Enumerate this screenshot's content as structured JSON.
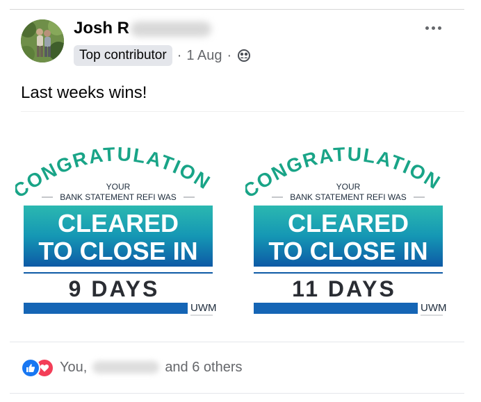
{
  "post": {
    "author_name": "Josh R",
    "badge": "Top contributor",
    "separator": "·",
    "date": "1 Aug",
    "audience_icon": "friends-icon",
    "more_icon": "more-dots-icon",
    "text": "Last weeks wins!"
  },
  "images": [
    {
      "arc_text": "CONGRATULATIONS",
      "line1": "YOUR",
      "line2": "BANK STATEMENT REFI WAS",
      "banner1": "CLEARED",
      "banner2": "TO CLOSE IN",
      "days": "9 DAYS",
      "brand": "UWM"
    },
    {
      "arc_text": "CONGRATULATIONS",
      "line1": "YOUR",
      "line2": "BANK STATEMENT REFI WAS",
      "banner1": "CLEARED",
      "banner2": "TO CLOSE IN",
      "days": "11 DAYS",
      "brand": "UWM"
    }
  ],
  "reactions": {
    "icons": [
      "like-icon",
      "love-icon"
    ],
    "you_label": "You,",
    "others_label": "and 6 others"
  },
  "colors": {
    "arc_teal": "#19a487",
    "banner_teal_top": "#27b3ac",
    "banner_blue_bottom": "#0f5aa6",
    "days_bar_blue": "#1565b5",
    "like_blue": "#1877f2",
    "love_red": "#f33e58"
  }
}
